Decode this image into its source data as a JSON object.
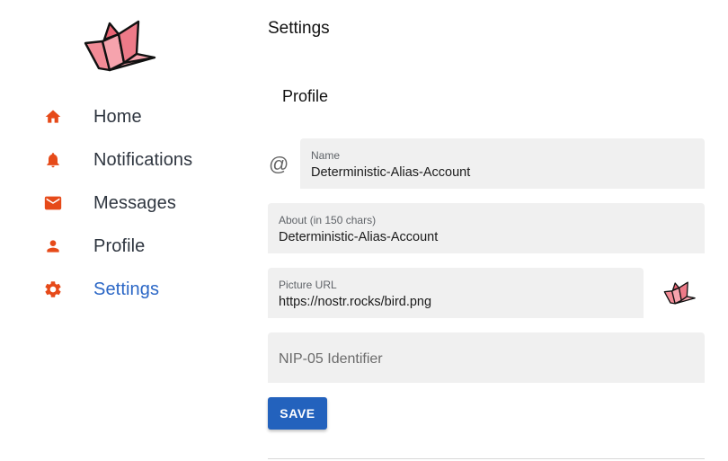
{
  "colors": {
    "accent": "#2b67c6",
    "nav_icon": "#e64a19",
    "button": "#2362bd"
  },
  "nav": {
    "items": [
      {
        "label": "Home",
        "icon": "home-icon"
      },
      {
        "label": "Notifications",
        "icon": "bell-icon"
      },
      {
        "label": "Messages",
        "icon": "mail-icon"
      },
      {
        "label": "Profile",
        "icon": "person-icon"
      },
      {
        "label": "Settings",
        "icon": "gear-icon",
        "active": true
      }
    ]
  },
  "page": {
    "title": "Settings"
  },
  "profile": {
    "section_title": "Profile",
    "name_label": "Name",
    "name_value": "Deterministic-Alias-Account",
    "about_label": "About (in 150 chars)",
    "about_value": "Deterministic-Alias-Account",
    "picture_label": "Picture URL",
    "picture_value": "https://nostr.rocks/bird.png",
    "nip05_placeholder": "NIP-05 Identifier",
    "save_label": "SAVE",
    "at_symbol": "@"
  }
}
